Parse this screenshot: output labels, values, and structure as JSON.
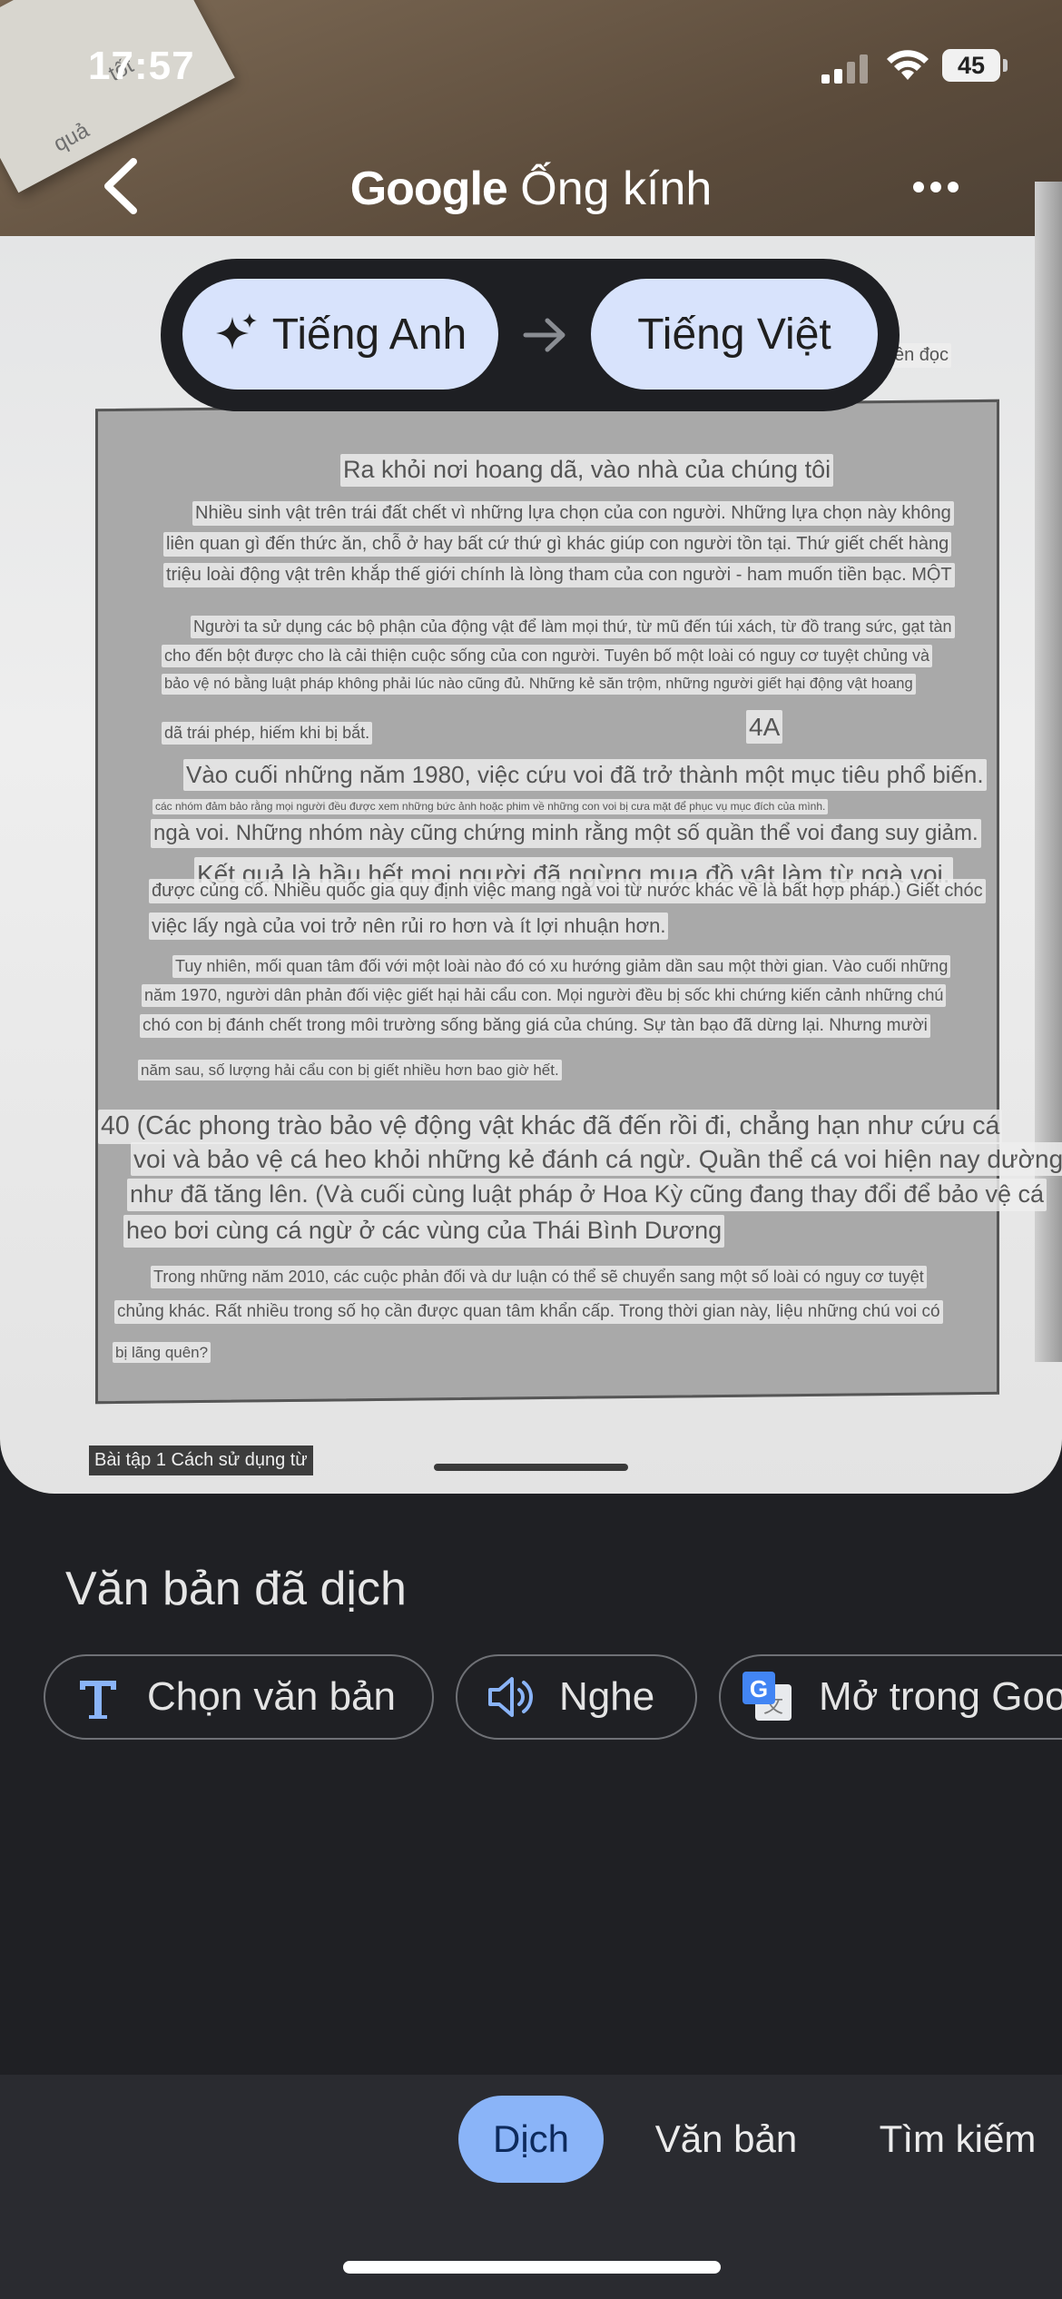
{
  "status_bar": {
    "time": "17:57",
    "battery": "45"
  },
  "app_bar": {
    "brand": "Google",
    "title": "Ống kính"
  },
  "language": {
    "source": "Tiếng Anh",
    "target": "Tiếng Việt"
  },
  "background_paper": {
    "sticky_note_top": "tốt",
    "sticky_note_side": "quả",
    "corner_text": "ên đọc"
  },
  "document": {
    "title": "Ra khỏi nơi hoang dã, vào nhà của chúng tôi",
    "p1": [
      "Nhiều sinh vật trên trái đất chết vì những lựa chọn của con người. Những lựa chọn này không",
      "liên quan gì đến thức ăn, chỗ ở hay bất cứ thứ gì khác giúp con người tồn tại. Thứ giết chết hàng",
      "triệu loài động vật trên khắp thế giới chính là lòng tham của con người - ham muốn tiền bạc. MỘT"
    ],
    "p2": [
      "Người ta sử dụng các bộ phận của động vật để làm mọi thứ, từ mũ đến túi xách, từ đồ trang sức, gạt tàn",
      "cho đến bột được cho là cải thiện cuộc sống của con người. Tuyên bố một loài có nguy cơ tuyệt chủng và",
      "bảo vệ nó bằng luật pháp không phải lúc nào cũng đủ. Những kẻ săn trộm, những người giết hại động vật hoang",
      "dã trái phép, hiếm khi bị bắt."
    ],
    "label_4a": "4A",
    "p3": [
      "Vào cuối những năm 1980, việc cứu voi đã trở thành một mục tiêu phổ biến.",
      "các nhóm đảm bảo rằng mọi người đều được xem những bức ảnh hoặc phim về những con voi bị cưa mặt để phục vụ mục đích của mình.",
      "ngà voi. Những nhóm này cũng chứng minh rằng một số quần thể voi đang suy giảm.",
      "Kết quả là hầu hết mọi người đã ngừng mua đồ vật làm từ ngà voi.",
      "được củng cố. Nhiều quốc gia quy định việc mang ngà voi từ nước khác về là bất hợp pháp.) Giết chóc",
      "việc lấy ngà của voi trở nên rủi ro hơn và ít lợi nhuận hơn."
    ],
    "p4": [
      "Tuy nhiên, mối quan tâm đối với một loài nào đó có xu hướng giảm dần sau một thời gian. Vào cuối những",
      "năm 1970, người dân phản đối việc giết hại hải cẩu con. Mọi người đều bị sốc khi chứng kiến cảnh những chú",
      "chó con bị đánh chết trong môi trường sống băng giá của chúng. Sự tàn bạo đã dừng lại. Nhưng mười",
      "năm sau, số lượng hải cẩu con bị giết nhiều hơn bao giờ hết."
    ],
    "p5": [
      "40 (Các phong trào bảo vệ động vật khác đã đến rồi đi, chẳng hạn như cứu cá",
      "voi và bảo vệ cá heo khỏi những kẻ đánh cá ngừ. Quần thể cá voi hiện nay dường",
      "như đã tăng lên. (Và cuối cùng luật pháp ở Hoa Kỳ cũng đang thay đổi để bảo vệ cá",
      "heo bơi cùng cá ngừ ở các vùng của Thái Bình Dương"
    ],
    "p6": [
      "Trong những năm 2010, các cuộc phản đối và dư luận có thể sẽ chuyển sang một số loài có nguy cơ tuyệt",
      "chủng khác. Rất nhiều trong số họ cần được quan tâm khẩn cấp. Trong thời gian này, liệu những chú voi có",
      "bị lãng quên?"
    ],
    "exercise_label": "Bài tập 1 Cách sử dụng từ"
  },
  "sheet": {
    "title": "Văn bản đã dịch",
    "actions": {
      "select_text": "Chọn văn bản",
      "listen": "Nghe",
      "open_in_translate": "Mở trong Google Dịch"
    }
  },
  "tabs": {
    "translate": "Dịch",
    "text": "Văn bản",
    "search": "Tìm kiếm"
  },
  "colors": {
    "chip": "#d8e3fc",
    "active_tab": "#8ab4f8",
    "background": "#1f2024"
  }
}
